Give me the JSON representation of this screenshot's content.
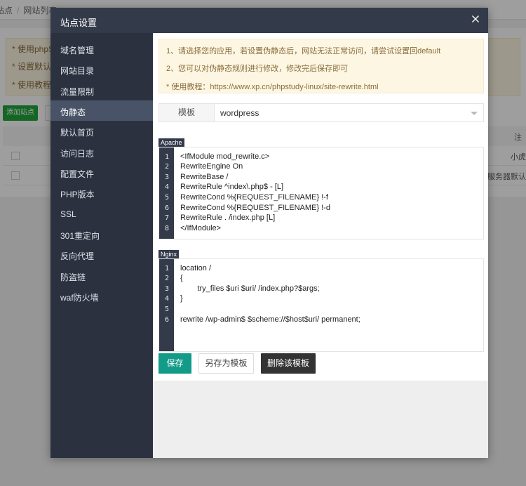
{
  "background": {
    "breadcrumb": [
      "站点",
      "网站列表"
    ],
    "tips": [
      "* 使用phpStu",
      "* 设置默认站",
      "* 使用教程："
    ],
    "add_site_label": "添加站点",
    "table_header_right": "注",
    "rows": [
      {
        "right": "小虎"
      },
      {
        "right": "b 服务器默认"
      }
    ]
  },
  "dialog": {
    "title": "站点设置",
    "close_icon": "close-icon",
    "sidebar": [
      {
        "label": "域名管理",
        "active": false
      },
      {
        "label": "网站目录",
        "active": false
      },
      {
        "label": "流量限制",
        "active": false
      },
      {
        "label": "伪静态",
        "active": true
      },
      {
        "label": "默认首页",
        "active": false
      },
      {
        "label": "访问日志",
        "active": false
      },
      {
        "label": "配置文件",
        "active": false
      },
      {
        "label": "PHP版本",
        "active": false
      },
      {
        "label": "SSL",
        "active": false
      },
      {
        "label": "301重定向",
        "active": false
      },
      {
        "label": "反向代理",
        "active": false
      },
      {
        "label": "防盗链",
        "active": false
      },
      {
        "label": "waf防火墙",
        "active": false
      }
    ],
    "notice": [
      "1、请选择您的应用，若设置伪静态后，网站无法正常访问，请尝试设置回default",
      "2、您可以对伪静态规则进行修改，修改完后保存即可",
      "* 使用教程：https://www.xp.cn/phpstudy-linux/site-rewrite.html"
    ],
    "template": {
      "label": "模板",
      "value": "wordpress"
    },
    "apache": {
      "tag": "Apache",
      "lines": [
        "<IfModule mod_rewrite.c>",
        "RewriteEngine On",
        "RewriteBase /",
        "RewriteRule ^index\\.php$ - [L]",
        "RewriteCond %{REQUEST_FILENAME} !-f",
        "RewriteCond %{REQUEST_FILENAME} !-d",
        "RewriteRule . /index.php [L]",
        "</IfModule>"
      ]
    },
    "nginx": {
      "tag": "Nginx",
      "lines": [
        "location /",
        "{",
        "        try_files $uri $uri/ /index.php?$args;",
        "}",
        "",
        "rewrite /wp-admin$ $scheme://$host$uri/ permanent;"
      ]
    },
    "buttons": {
      "save": "保存",
      "save_as_template": "另存为模板",
      "delete_template": "删除该模板"
    }
  },
  "colors": {
    "header": "#333a4a",
    "sidebar": "#2c3140",
    "sidebar_active": "#495367",
    "save_button": "#129b88",
    "delete_button": "#333333",
    "notice_bg": "#fdf6e3",
    "notice_text": "#8a6d3b"
  }
}
